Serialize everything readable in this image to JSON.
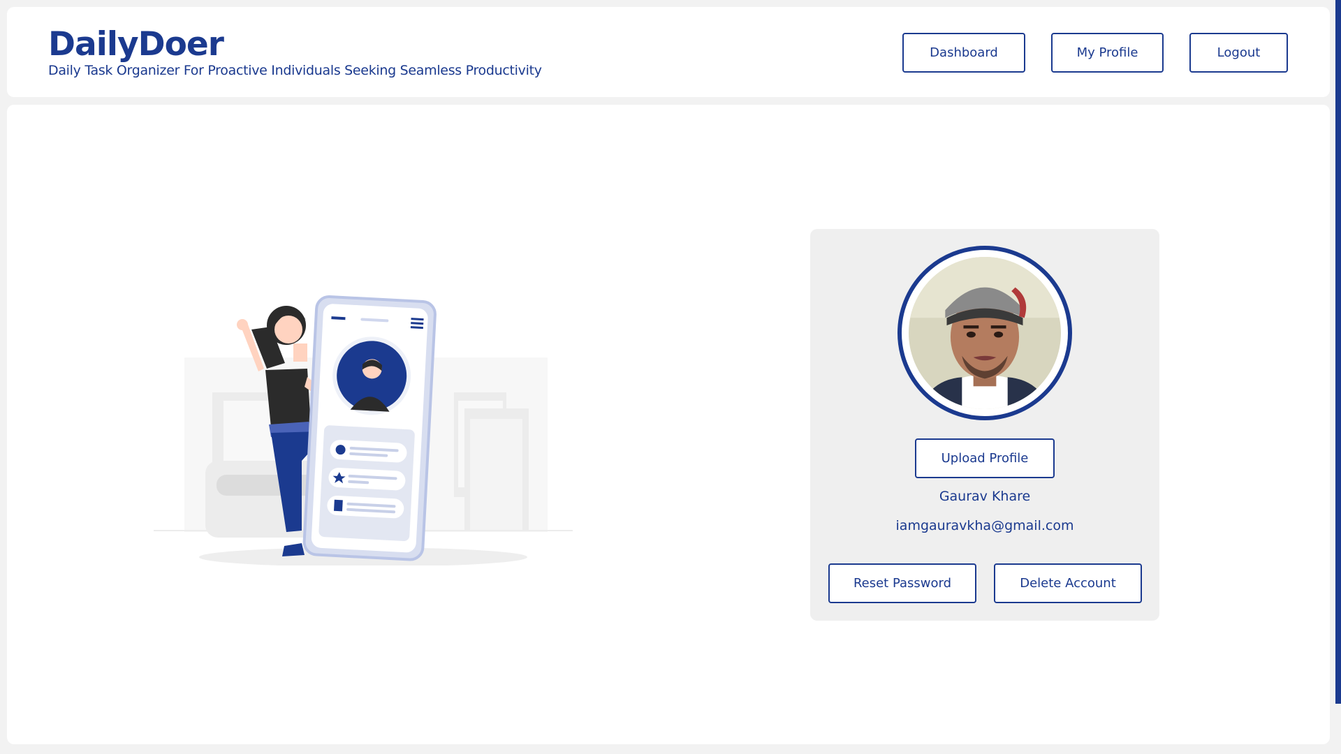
{
  "header": {
    "title": "DailyDoer",
    "subtitle": "Daily Task Organizer For Proactive Individuals Seeking Seamless Productivity",
    "nav": {
      "dashboard": "Dashboard",
      "profile": "My Profile",
      "logout": "Logout"
    }
  },
  "profile": {
    "upload_label": "Upload Profile",
    "name": "Gaurav Khare",
    "email": "iamgauravkha@gmail.com",
    "reset_label": "Reset Password",
    "delete_label": "Delete Account"
  },
  "colors": {
    "brand": "#1b3a8f",
    "card_bg": "#efefef",
    "page_bg": "#f2f2f2"
  },
  "icons": [
    "profile-illustration",
    "user-avatar-photo"
  ]
}
